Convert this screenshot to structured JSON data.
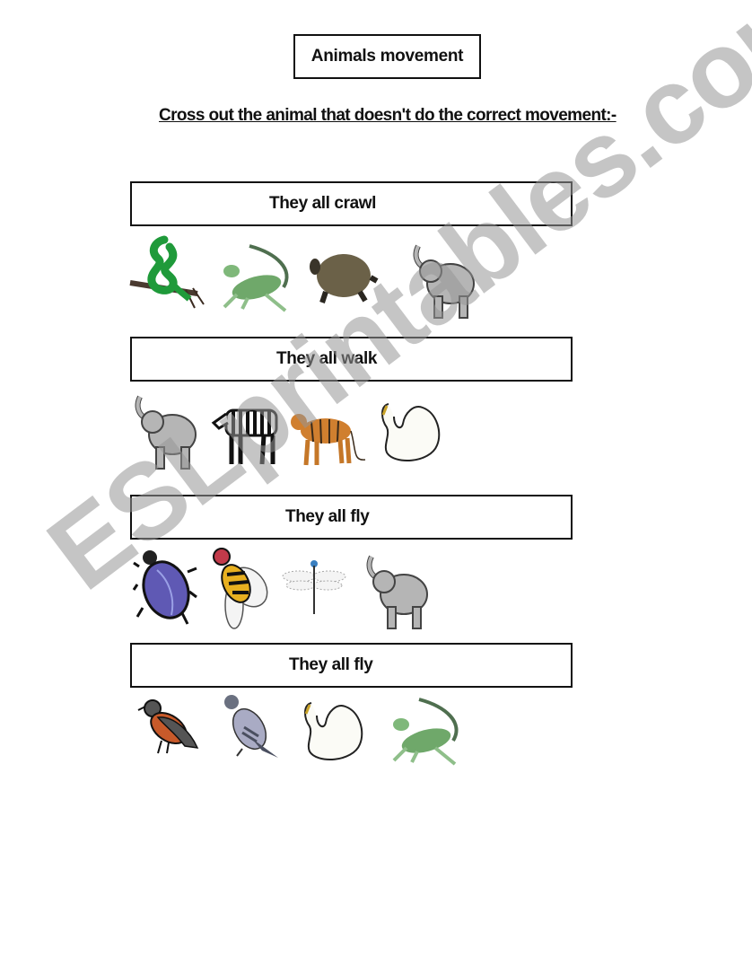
{
  "title": "Animals movement",
  "instruction": "Cross out the animal that doesn't do the correct movement:-",
  "sections": [
    {
      "heading": "They all crawl",
      "animals": [
        "snake",
        "iguana",
        "turtle",
        "elephant"
      ]
    },
    {
      "heading": "They all walk",
      "animals": [
        "elephant",
        "zebra",
        "tiger",
        "swan"
      ]
    },
    {
      "heading": "They all fly",
      "animals": [
        "beetle",
        "fly",
        "dragonfly",
        "elephant"
      ]
    },
    {
      "heading": "They all fly",
      "animals": [
        "robin",
        "pigeon",
        "swan",
        "iguana"
      ]
    }
  ],
  "watermark": "ESLprintables.com"
}
